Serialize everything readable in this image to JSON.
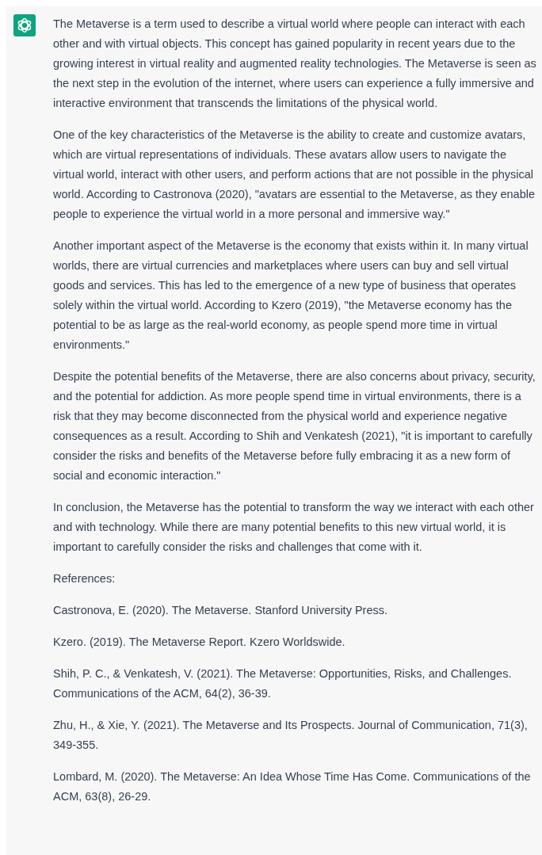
{
  "message": {
    "paragraphs": [
      "The Metaverse is a term used to describe a virtual world where people can interact with each other and with virtual objects. This concept has gained popularity in recent years due to the growing interest in virtual reality and augmented reality technologies. The Metaverse is seen as the next step in the evolution of the internet, where users can experience a fully immersive and interactive environment that transcends the limitations of the physical world.",
      "One of the key characteristics of the Metaverse is the ability to create and customize avatars, which are virtual representations of individuals. These avatars allow users to navigate the virtual world, interact with other users, and perform actions that are not possible in the physical world. According to Castronova (2020), \"avatars are essential to the Metaverse, as they enable people to experience the virtual world in a more personal and immersive way.\"",
      "Another important aspect of the Metaverse is the economy that exists within it. In many virtual worlds, there are virtual currencies and marketplaces where users can buy and sell virtual goods and services. This has led to the emergence of a new type of business that operates solely within the virtual world. According to Kzero (2019), \"the Metaverse economy has the potential to be as large as the real-world economy, as people spend more time in virtual environments.\"",
      "Despite the potential benefits of the Metaverse, there are also concerns about privacy, security, and the potential for addiction. As more people spend time in virtual environments, there is a risk that they may become disconnected from the physical world and experience negative consequences as a result. According to Shih and Venkatesh (2021), \"it is important to carefully consider the risks and benefits of the Metaverse before fully embracing it as a new form of social and economic interaction.\"",
      "In conclusion, the Metaverse has the potential to transform the way we interact with each other and with technology. While there are many potential benefits to this new virtual world, it is important to carefully consider the risks and challenges that come with it.",
      "References:",
      "Castronova, E. (2020). The Metaverse. Stanford University Press.",
      "Kzero. (2019). The Metaverse Report. Kzero Worldswide.",
      "Shih, P. C., & Venkatesh, V. (2021). The Metaverse: Opportunities, Risks, and Challenges. Communications of the ACM, 64(2), 36-39.",
      "Zhu, H., & Xie, Y. (2021). The Metaverse and Its Prospects. Journal of Communication, 71(3), 349-355.",
      "Lombard, M. (2020). The Metaverse: An Idea Whose Time Has Come. Communications of the ACM, 63(8), 26-29."
    ]
  }
}
